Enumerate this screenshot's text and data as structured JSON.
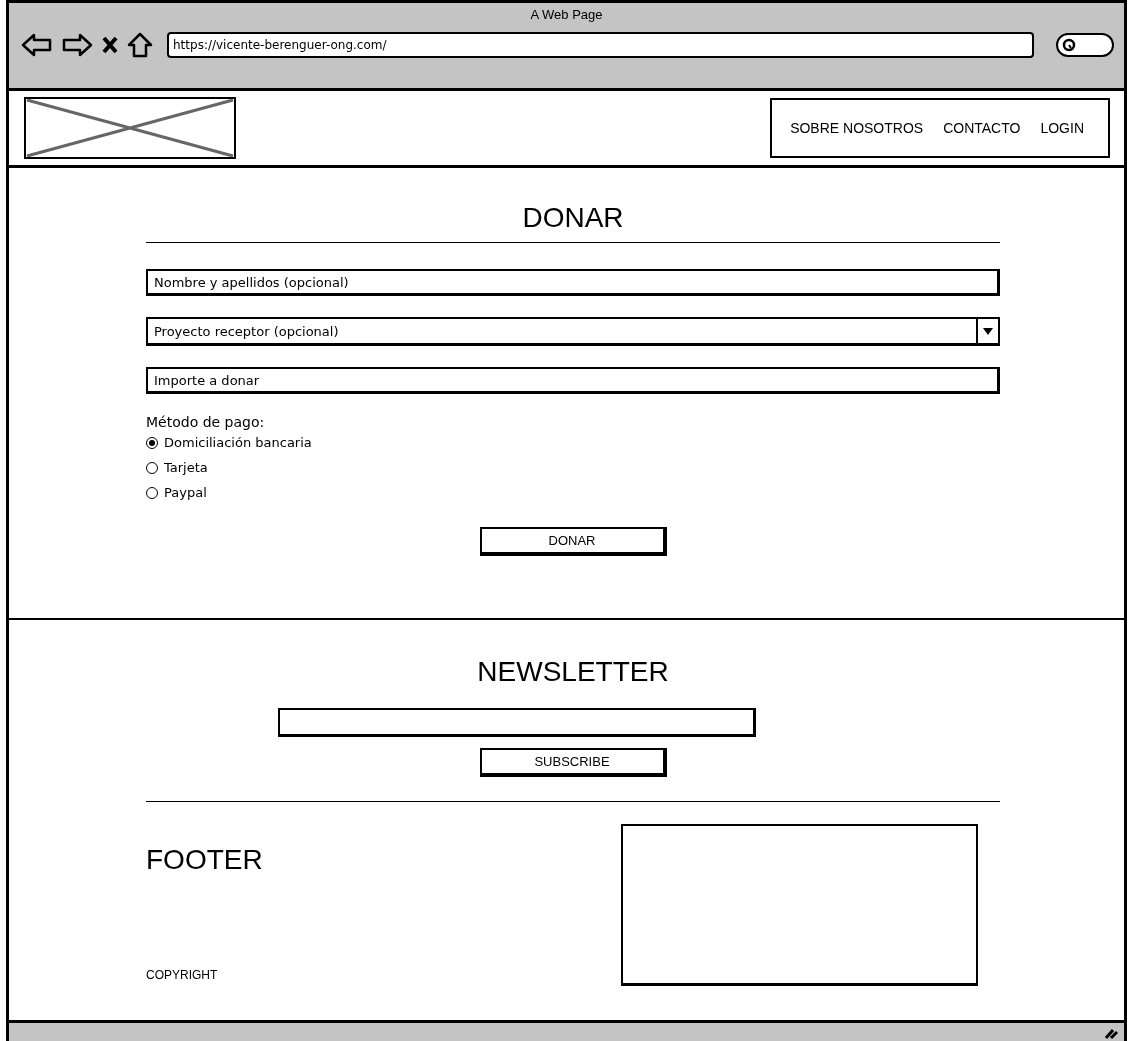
{
  "browser": {
    "title": "A Web Page",
    "url": "https://vicente-berenguer-ong.com/"
  },
  "header": {
    "nav": [
      "SOBRE NOSOTROS",
      "CONTACTO",
      "LOGIN"
    ]
  },
  "donate": {
    "title": "DONAR",
    "fields": [
      {
        "kind": "text",
        "placeholder": "Nombre y apellidos (opcional)"
      },
      {
        "kind": "select",
        "value": "Proyecto receptor (opcional)"
      },
      {
        "kind": "text",
        "placeholder": "Importe a donar"
      }
    ],
    "payment_label": "Método de pago:",
    "payment_options": [
      {
        "label": "Domiciliación bancaria",
        "selected": true
      },
      {
        "label": "Tarjeta",
        "selected": false
      },
      {
        "label": "Paypal",
        "selected": false
      }
    ],
    "button": "DONAR"
  },
  "newsletter": {
    "title": "NEWSLETTER",
    "button": "SUBSCRIBE"
  },
  "footer": {
    "title": "FOOTER",
    "copyright": "COPYRIGHT"
  }
}
